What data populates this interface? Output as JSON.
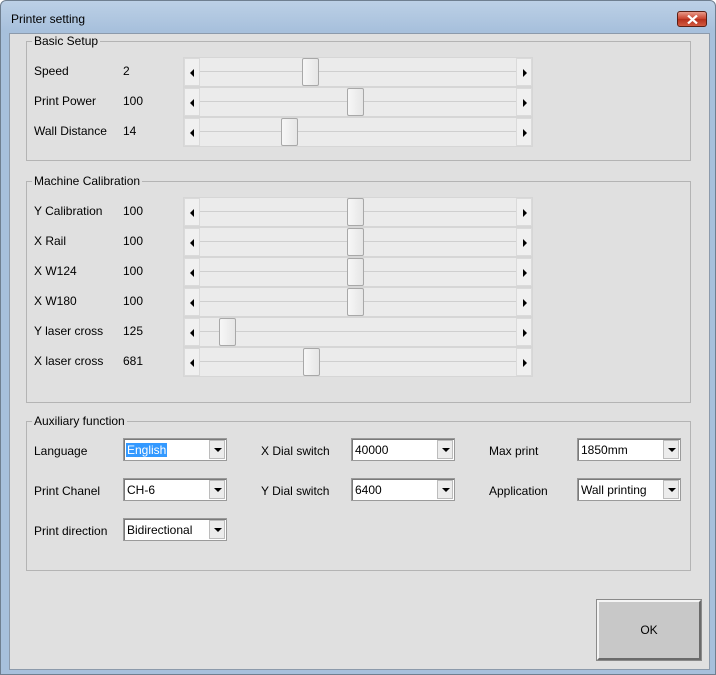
{
  "window": {
    "title": "Printer setting"
  },
  "basic_setup": {
    "title": "Basic Setup",
    "rows": [
      {
        "label": "Speed",
        "value": "2",
        "position": 0.34
      },
      {
        "label": "Print Power",
        "value": "100",
        "position": 0.49
      },
      {
        "label": "Wall Distance",
        "value": "14",
        "position": 0.27
      }
    ]
  },
  "machine_calibration": {
    "title": "Machine Calibration",
    "rows": [
      {
        "label": "Y Calibration",
        "value": "100",
        "position": 0.49
      },
      {
        "label": "X Rail",
        "value": "100",
        "position": 0.49
      },
      {
        "label": "X W124",
        "value": "100",
        "position": 0.49
      },
      {
        "label": "X W180",
        "value": "100",
        "position": 0.49
      },
      {
        "label": "Y laser cross",
        "value": "125",
        "position": 0.065
      },
      {
        "label": "X laser cross",
        "value": "681",
        "position": 0.345
      }
    ]
  },
  "auxiliary": {
    "title": "Auxiliary function",
    "language": {
      "label": "Language",
      "value": "English"
    },
    "print_chanel": {
      "label": "Print Chanel",
      "value": "CH-6"
    },
    "print_direction": {
      "label": "Print direction",
      "value": "Bidirectional"
    },
    "x_dial": {
      "label": "X Dial switch",
      "value": "40000"
    },
    "y_dial": {
      "label": "Y Dial switch",
      "value": "6400"
    },
    "max_print": {
      "label": "Max print",
      "value": "1850mm"
    },
    "application": {
      "label": "Application",
      "value": "Wall printing"
    }
  },
  "buttons": {
    "ok": "OK"
  },
  "colors": {
    "selection": "#3399ff",
    "close_button": "#c8412c"
  }
}
